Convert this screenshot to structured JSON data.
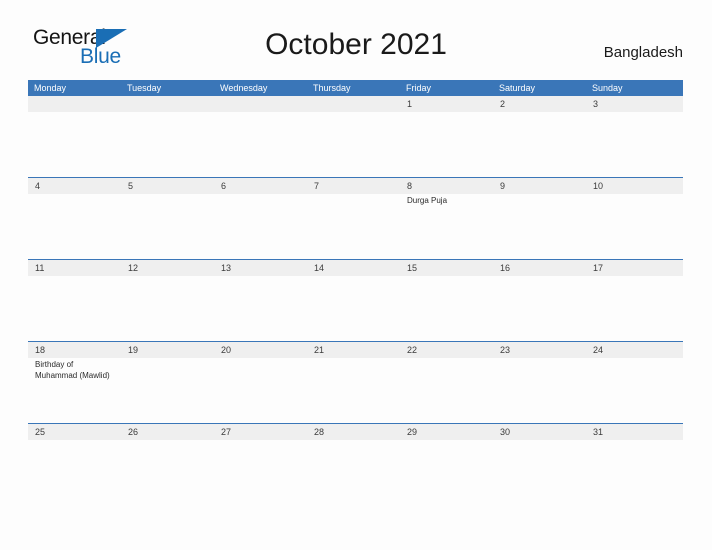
{
  "brand": {
    "name_part1": "General",
    "name_part2": "Blue",
    "triangle_color": "#1a6eb5"
  },
  "header": {
    "title": "October 2021",
    "region": "Bangladesh"
  },
  "theme": {
    "header_blue": "#3a76b8",
    "band_gray": "#efefef",
    "page_background": "#fdfdfd",
    "text_color": "#1a1a1a"
  },
  "calendar": {
    "month": "October",
    "year": "2021",
    "weekdays": [
      "Monday",
      "Tuesday",
      "Wednesday",
      "Thursday",
      "Friday",
      "Saturday",
      "Sunday"
    ],
    "weeks": [
      {
        "days": [
          {
            "number": "",
            "events": []
          },
          {
            "number": "",
            "events": []
          },
          {
            "number": "",
            "events": []
          },
          {
            "number": "",
            "events": []
          },
          {
            "number": "1",
            "events": []
          },
          {
            "number": "2",
            "events": []
          },
          {
            "number": "3",
            "events": []
          }
        ]
      },
      {
        "days": [
          {
            "number": "4",
            "events": []
          },
          {
            "number": "5",
            "events": []
          },
          {
            "number": "6",
            "events": []
          },
          {
            "number": "7",
            "events": []
          },
          {
            "number": "8",
            "events": [
              "Durga Puja"
            ]
          },
          {
            "number": "9",
            "events": []
          },
          {
            "number": "10",
            "events": []
          }
        ]
      },
      {
        "days": [
          {
            "number": "11",
            "events": []
          },
          {
            "number": "12",
            "events": []
          },
          {
            "number": "13",
            "events": []
          },
          {
            "number": "14",
            "events": []
          },
          {
            "number": "15",
            "events": []
          },
          {
            "number": "16",
            "events": []
          },
          {
            "number": "17",
            "events": []
          }
        ]
      },
      {
        "days": [
          {
            "number": "18",
            "events": [
              "Birthday of Muhammad (Mawlid)"
            ]
          },
          {
            "number": "19",
            "events": []
          },
          {
            "number": "20",
            "events": []
          },
          {
            "number": "21",
            "events": []
          },
          {
            "number": "22",
            "events": []
          },
          {
            "number": "23",
            "events": []
          },
          {
            "number": "24",
            "events": []
          }
        ]
      },
      {
        "days": [
          {
            "number": "25",
            "events": []
          },
          {
            "number": "26",
            "events": []
          },
          {
            "number": "27",
            "events": []
          },
          {
            "number": "28",
            "events": []
          },
          {
            "number": "29",
            "events": []
          },
          {
            "number": "30",
            "events": []
          },
          {
            "number": "31",
            "events": []
          }
        ]
      }
    ]
  }
}
